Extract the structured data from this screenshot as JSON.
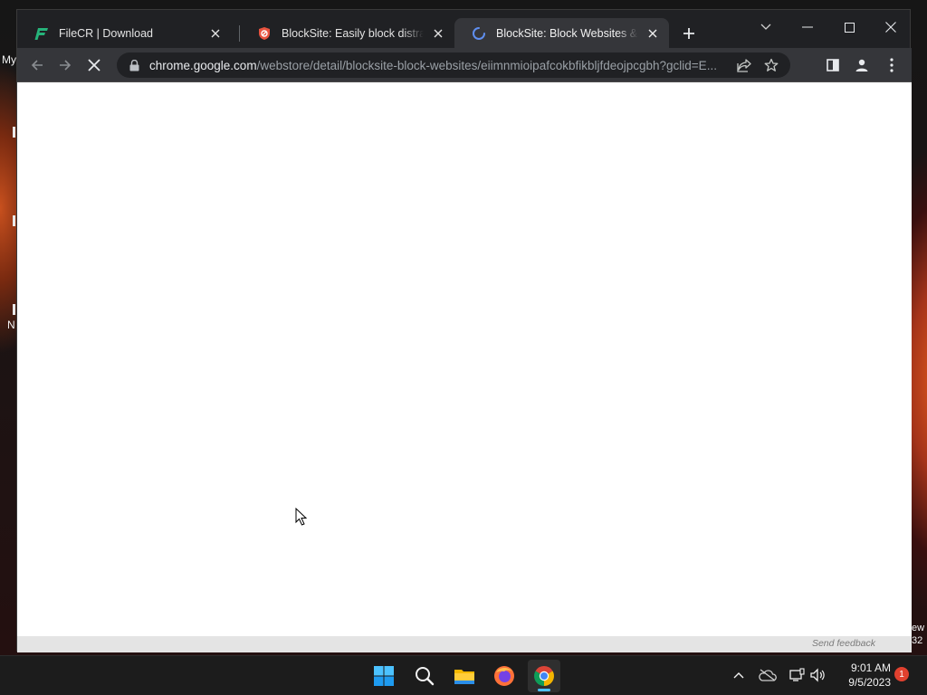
{
  "desktop": {
    "fragment_my": "My",
    "fragment_n": "N",
    "fragment_ew": "ew",
    "fragment_num": "32"
  },
  "browser": {
    "tabs": [
      {
        "title": "FileCR | Download",
        "icon": "filecr-logo-icon"
      },
      {
        "title": "BlockSite: Easily block distracting",
        "icon": "blocksite-shield-icon"
      },
      {
        "title": "BlockSite: Block Websites & Stay",
        "icon": "loading-spinner-icon",
        "active": true
      }
    ],
    "url_host": "chrome.google.com",
    "url_path": "/webstore/detail/blocksite-block-websites/eiimnmioipafcokbfikbljfdeojpcgbh?gclid=E...",
    "send_feedback": "Send feedback"
  },
  "taskbar": {
    "apps": [
      "windows-start-icon",
      "search-icon",
      "file-explorer-icon",
      "firefox-icon",
      "chrome-icon"
    ],
    "clock_time": "9:01 AM",
    "clock_date": "9/5/2023",
    "notification_count": "1"
  },
  "colors": {
    "accent": "#4cc2ff",
    "tab_active": "#35363a",
    "frame": "#202124",
    "badge": "#e1412f"
  }
}
